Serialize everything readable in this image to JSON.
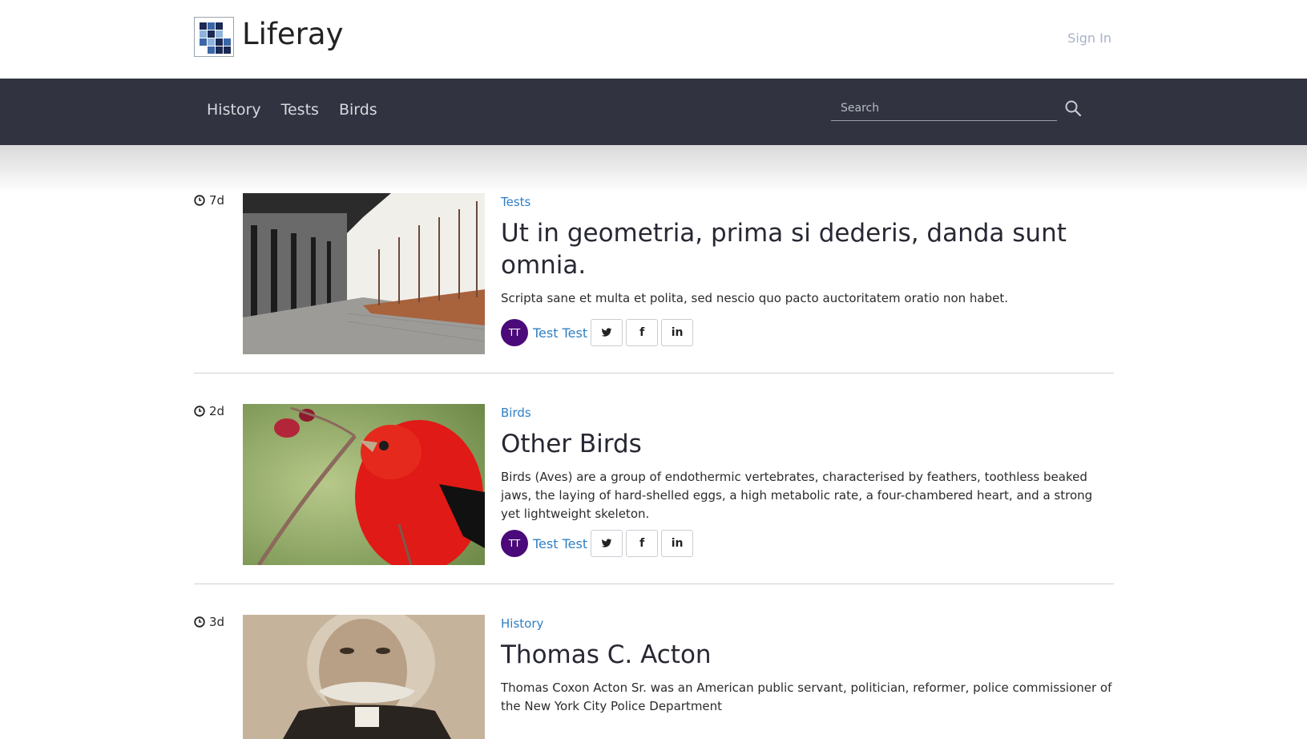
{
  "header": {
    "brand": "Liferay",
    "sign_in": "Sign In"
  },
  "nav": {
    "items": [
      {
        "label": "History"
      },
      {
        "label": "Tests"
      },
      {
        "label": "Birds"
      }
    ],
    "search_placeholder": "Search"
  },
  "posts": [
    {
      "age": "7d",
      "category": "Tests",
      "title": "Ut in geometria, prima si dederis, danda sunt omnia.",
      "summary": "Scripta sane et multa et polita, sed nescio quo pacto auctoritatem oratio non habet.",
      "avatar": "TT",
      "author": "Test Test",
      "image": "building-walkway"
    },
    {
      "age": "2d",
      "category": "Birds",
      "title": "Other Birds",
      "summary": "Birds (Aves) are a group of endothermic vertebrates, characterised by feathers, toothless beaked jaws, the laying of hard-shelled eggs, a high metabolic rate, a four-chambered heart, and a strong yet lightweight skeleton.",
      "avatar": "TT",
      "author": "Test Test",
      "image": "red-bird"
    },
    {
      "age": "3d",
      "category": "History",
      "title": "Thomas C. Acton",
      "summary": "Thomas Coxon Acton Sr. was an American public servant, politician, reformer, police commissioner of the New York City Police Department",
      "image": "portrait"
    }
  ],
  "share_icons": [
    "twitter-icon",
    "facebook-icon",
    "linkedin-icon"
  ],
  "colors": {
    "navbar": "#313440",
    "link": "#2f7fc4",
    "avatar": "#4a0a7a",
    "sign_in": "#a7b3c7"
  }
}
